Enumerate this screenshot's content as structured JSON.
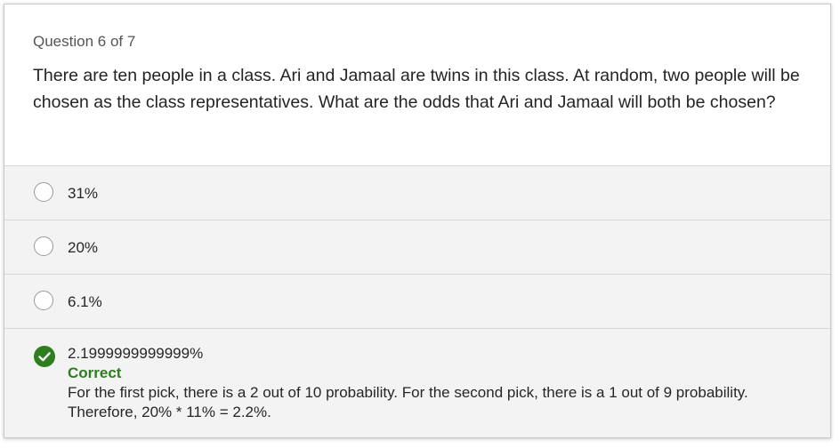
{
  "question": {
    "counter": "Question 6 of 7",
    "text": "There are ten people in a class. Ari and Jamaal are twins in this class. At random, two people will be chosen as the class representatives. What are the odds that Ari and Jamaal will both be chosen?"
  },
  "options": [
    {
      "label": "31%",
      "selected": false
    },
    {
      "label": "20%",
      "selected": false
    },
    {
      "label": "6.1%",
      "selected": false
    },
    {
      "label": "2.1999999999999%",
      "selected": true
    }
  ],
  "feedback": {
    "status": "Correct",
    "explanation": "For the first pick, there is a 2 out of 10 probability. For the second pick, there is a 1 out of 9 probability. Therefore, 20% * 11% = 2.2%."
  },
  "icons": {
    "radio": "radio-empty-icon",
    "selected": "check-circle-icon"
  },
  "colors": {
    "correct": "#2e7d1f",
    "option_bg": "#f3f3f3"
  }
}
